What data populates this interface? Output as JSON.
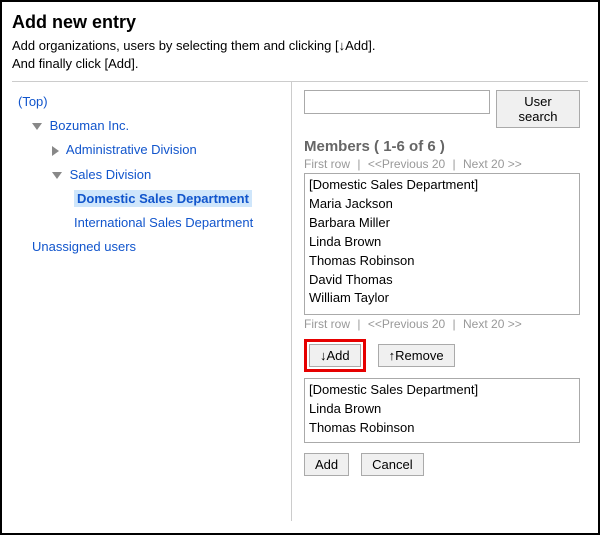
{
  "header": {
    "title": "Add new entry",
    "sub1": "Add organizations, users by selecting them and clicking [↓Add].",
    "sub2": "And finally click [Add]."
  },
  "tree": {
    "top": "(Top)",
    "org": "Bozuman Inc.",
    "admin": "Administrative Division",
    "sales": "Sales Division",
    "domestic": "Domestic Sales Department",
    "intl": "International Sales Department",
    "unassigned": "Unassigned users"
  },
  "search": {
    "value": "",
    "button": "User search"
  },
  "members": {
    "heading": "Members ( 1-6 of 6 )",
    "pager_first": "First row",
    "pager_prev": "<<Previous 20",
    "pager_next": "Next 20 >>",
    "list": [
      "[Domestic Sales Department]",
      "Maria Jackson",
      "Barbara Miller",
      "Linda Brown",
      "Thomas Robinson",
      "David Thomas",
      "William Taylor"
    ]
  },
  "actions": {
    "add_down": "↓Add",
    "remove_up": "↑Remove"
  },
  "selected_list": [
    "[Domestic Sales Department]",
    "Linda Brown",
    "Thomas Robinson"
  ],
  "final": {
    "add": "Add",
    "cancel": "Cancel"
  }
}
